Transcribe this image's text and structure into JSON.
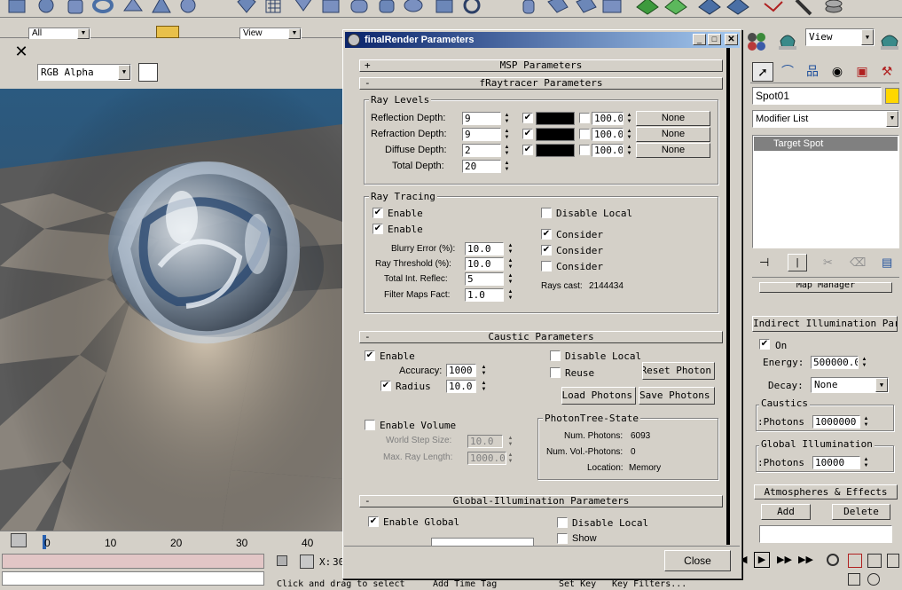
{
  "viewport_toolbar": {
    "close_glyph": "✕",
    "channel_select": "RGB Alpha"
  },
  "top_toolbar": {
    "filter_select": "All",
    "view_select": "View",
    "right_view_select": "View"
  },
  "timeline": {
    "ticks": [
      "0",
      "10",
      "20",
      "30",
      "40"
    ]
  },
  "status_bar": {
    "coord_label": "X:",
    "coord_value": "30",
    "prompt": "Click and drag to select",
    "add_time_tag": "Add Time Tag",
    "set_key": "Set Key",
    "key_filters": "Key Filters..."
  },
  "dialog": {
    "title": "finalRender Parameters",
    "close_button": "Close",
    "rollouts": {
      "msp": {
        "sign": "+",
        "title": "MSP Parameters"
      },
      "fraytracer": {
        "sign": "-",
        "title": "fRaytracer Parameters"
      },
      "caustic": {
        "sign": "-",
        "title": "Caustic Parameters"
      },
      "gi": {
        "sign": "-",
        "title": "Global-Illumination Parameters"
      }
    },
    "ray_levels": {
      "title": "Ray Levels",
      "rows": [
        {
          "label": "Reflection Depth:",
          "value": "9",
          "checked": "✔",
          "percent": "100.0",
          "map": "None"
        },
        {
          "label": "Refraction Depth:",
          "value": "9",
          "checked": "✔",
          "percent": "100.0",
          "map": "None"
        },
        {
          "label": "Diffuse Depth:",
          "value": "2",
          "checked": "✔",
          "percent": "100.0",
          "map": "None"
        }
      ],
      "total_label": "Total Depth:",
      "total_value": "20"
    },
    "ray_tracing": {
      "title": "Ray Tracing",
      "enable1": "Enable",
      "enable2": "Enable",
      "disable_local": "Disable Local",
      "consider1": "Consider",
      "consider2": "Consider",
      "consider3": "Consider",
      "blurry_label": "Blurry Error (%):",
      "blurry_value": "10.0",
      "threshold_label": "Ray Threshold (%):",
      "threshold_value": "10.0",
      "total_int_label": "Total Int. Reflec:",
      "total_int_value": "5",
      "filter_label": "Filter Maps Fact:",
      "filter_value": "1.0",
      "rays_cast_label": "Rays cast:",
      "rays_cast_value": "2144434",
      "check": "✔"
    },
    "caustic": {
      "enable": "Enable",
      "accuracy_label": "Accuracy:",
      "accuracy_value": "1000",
      "radius": "Radius",
      "radius_value": "10.0",
      "disable_local": "Disable Local",
      "reuse": "Reuse",
      "reset_photon": "Reset Photon",
      "load_photons": "Load Photons",
      "save_photons": "Save Photons",
      "enable_volume": "Enable Volume",
      "world_step_label": "World Step Size:",
      "world_step_value": "10.0",
      "max_ray_label": "Max. Ray Length:",
      "max_ray_value": "1000.0",
      "photontree_title": "PhotonTree-State",
      "num_photons_label": "Num. Photons:",
      "num_photons_value": "6093",
      "num_vol_label": "Num. Vol.-Photons:",
      "num_vol_value": "0",
      "location_label": "Location:",
      "location_value": "Memory",
      "check": "✔"
    },
    "gi": {
      "enable_global": "Enable Global",
      "disable_local": "Disable Local",
      "show": "Show",
      "check": "✔"
    }
  },
  "command_panel": {
    "object_name": "Spot01",
    "name_color": "#ffd700",
    "modifier_list": "Modifier List",
    "stack_items": [
      "Target Spot"
    ],
    "map_manager": "Map Manager",
    "indirect_title": "Indirect Illumination Par",
    "on_label": "On",
    "energy_label": "Energy:",
    "energy_value": "500000.0",
    "decay_label": "Decay:",
    "decay_value": "None",
    "caustics_title": "Caustics",
    "caustics_photons_label": "Photons:",
    "caustics_photons_value": "1000000",
    "gi_title": "Global Illumination",
    "gi_photons_label": "Photons:",
    "gi_photons_value": "10000",
    "atmos_title": "Atmospheres & Effects",
    "add_button": "Add",
    "delete_button": "Delete",
    "check": "✔"
  }
}
